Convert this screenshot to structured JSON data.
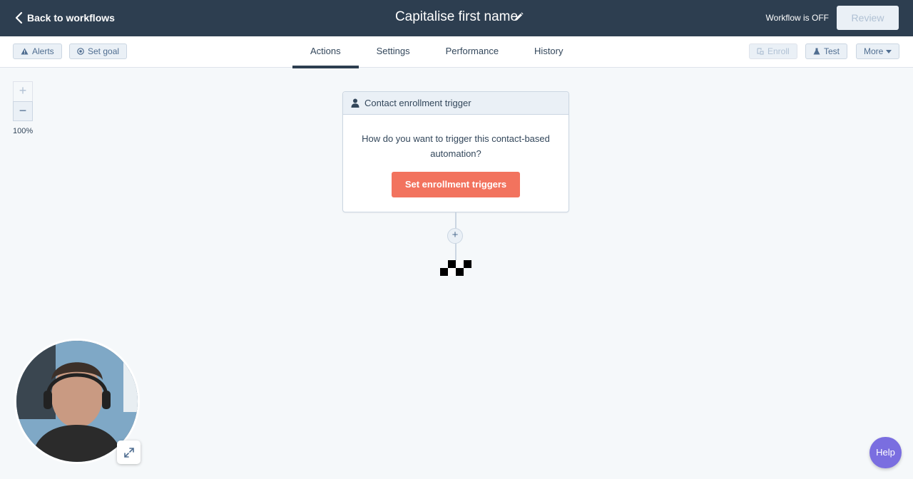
{
  "header": {
    "back_label": "Back to workflows",
    "title": "Capitalise first name",
    "status": "Workflow is OFF",
    "review_label": "Review"
  },
  "toolbar": {
    "alerts_label": "Alerts",
    "set_goal_label": "Set goal",
    "enroll_label": "Enroll",
    "test_label": "Test",
    "more_label": "More"
  },
  "tabs": [
    {
      "label": "Actions",
      "active": true
    },
    {
      "label": "Settings",
      "active": false
    },
    {
      "label": "Performance",
      "active": false
    },
    {
      "label": "History",
      "active": false
    }
  ],
  "zoom": {
    "plus": "+",
    "minus": "−",
    "level": "100%"
  },
  "trigger_card": {
    "title": "Contact enrollment trigger",
    "question": "How do you want to trigger this contact-based automation?",
    "button_label": "Set enrollment triggers"
  },
  "connector": {
    "add_symbol": "+"
  },
  "help": {
    "label": "Help"
  },
  "colors": {
    "topbar": "#2d3e50",
    "accent_orange": "#f2735e",
    "help_purple": "#7a6ee0",
    "canvas": "#f5f8fa"
  },
  "icons": [
    "chevron-left-icon",
    "pencil-icon",
    "warning-icon",
    "target-icon",
    "enroll-icon",
    "flask-icon",
    "caret-down-icon",
    "person-icon",
    "plus-icon",
    "finish-flag-icon",
    "expand-icon"
  ]
}
